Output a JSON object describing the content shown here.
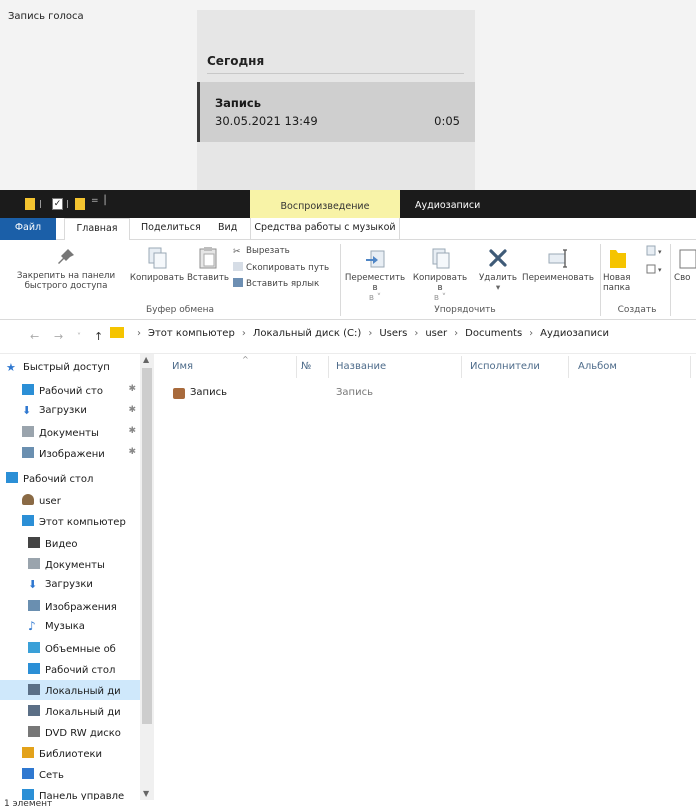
{
  "voice_recorder": {
    "app_title": "Запись голоса",
    "section": "Сегодня",
    "recording": {
      "name": "Запись",
      "datetime": "30.05.2021 13:49",
      "duration": "0:05"
    }
  },
  "explorer": {
    "title": "Аудиозаписи",
    "context_tab_group": "Воспроизведение",
    "tabs": {
      "file": "Файл",
      "home": "Главная",
      "share": "Поделиться",
      "view": "Вид",
      "music": "Средства работы с музыкой"
    },
    "ribbon": {
      "pin": "Закрепить на панели быстрого доступа",
      "copy": "Копировать",
      "paste": "Вставить",
      "cut": "Вырезать",
      "copy_path": "Скопировать путь",
      "paste_shortcut": "Вставить ярлык",
      "clipboard_group": "Буфер обмена",
      "move_to": "Переместить в",
      "copy_to": "Копировать в",
      "delete": "Удалить",
      "rename": "Переименовать",
      "organize_group": "Упорядочить",
      "new_folder": "Новая папка",
      "new_group": "Создать",
      "properties_partial": "Сво"
    },
    "address": {
      "crumbs": [
        "Этот компьютер",
        "Локальный диск (C:)",
        "Users",
        "user",
        "Documents",
        "Аудиозаписи"
      ]
    },
    "nav": {
      "items": [
        {
          "label": "Быстрый доступ",
          "icon": "star-icon",
          "color": "#2f78d0"
        },
        {
          "label": "Рабочий сто",
          "icon": "desktop-icon",
          "color": "#2b8fd6",
          "pinned": true
        },
        {
          "label": "Загрузки",
          "icon": "download-icon",
          "color": "#2f78d0",
          "pinned": true
        },
        {
          "label": "Документы",
          "icon": "documents-icon",
          "color": "#9aa4ad",
          "pinned": true
        },
        {
          "label": "Изображени",
          "icon": "pictures-icon",
          "color": "#6a8fb0",
          "pinned": true
        },
        {
          "label": "Рабочий стол",
          "icon": "desktop-icon",
          "color": "#2b8fd6"
        },
        {
          "label": "user",
          "icon": "user-icon",
          "color": "#8a6a45"
        },
        {
          "label": "Этот компьютер",
          "icon": "computer-icon",
          "color": "#2b8fd6"
        },
        {
          "label": "Видео",
          "icon": "video-icon",
          "color": "#444444"
        },
        {
          "label": "Документы",
          "icon": "documents-icon",
          "color": "#9aa4ad"
        },
        {
          "label": "Загрузки",
          "icon": "download-icon",
          "color": "#2f78d0"
        },
        {
          "label": "Изображения",
          "icon": "pictures-icon",
          "color": "#6a8fb0"
        },
        {
          "label": "Музыка",
          "icon": "music-icon",
          "color": "#2f78d0"
        },
        {
          "label": "Объемные об",
          "icon": "3d-objects-icon",
          "color": "#3aa0d8"
        },
        {
          "label": "Рабочий стол",
          "icon": "desktop-icon",
          "color": "#2b8fd6"
        },
        {
          "label": "Локальный ди",
          "icon": "drive-icon",
          "color": "#5b6f86",
          "selected": true
        },
        {
          "label": "Локальный ди",
          "icon": "drive-icon",
          "color": "#5b6f86"
        },
        {
          "label": "DVD RW диско",
          "icon": "dvd-icon",
          "color": "#777777"
        },
        {
          "label": "Библиотеки",
          "icon": "libraries-icon",
          "color": "#e3a21a"
        },
        {
          "label": "Сеть",
          "icon": "network-icon",
          "color": "#2f78d0"
        },
        {
          "label": "Панель управле",
          "icon": "control-panel-icon",
          "color": "#2b8fd6"
        }
      ]
    },
    "columns": {
      "name": "Имя",
      "number": "№",
      "title": "Название",
      "artists": "Исполнители",
      "album": "Альбом"
    },
    "files": [
      {
        "name": "Запись",
        "title": "Запись"
      }
    ],
    "status": "1 элемент"
  }
}
